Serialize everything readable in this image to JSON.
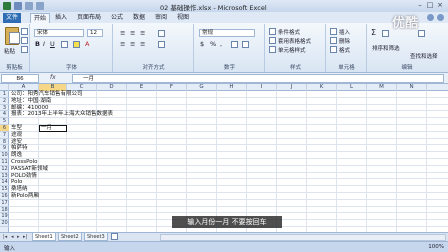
{
  "window": {
    "title": "02 基础操作.xlsx - Microsoft Excel",
    "controls": [
      "–",
      "□",
      "×"
    ]
  },
  "tabs": [
    "文件",
    "开始",
    "插入",
    "页面布局",
    "公式",
    "数据",
    "审阅",
    "视图"
  ],
  "active_tab": "开始",
  "ribbon": {
    "groups": [
      "剪贴板",
      "字体",
      "对齐方式",
      "数字",
      "样式",
      "单元格",
      "编辑"
    ],
    "font_name": "宋体",
    "font_size": "12",
    "number_format": "常规",
    "styles": [
      "条件格式",
      "套用表格格式",
      "单元格样式"
    ],
    "cells": [
      "插入",
      "删除",
      "格式"
    ],
    "editing": [
      "排序和筛选",
      "查找和选择"
    ],
    "paste_label": "粘贴"
  },
  "formula_bar": {
    "name_box": "B6",
    "fx": "fx",
    "content": "一月"
  },
  "columns": [
    "A",
    "B",
    "C",
    "D",
    "E",
    "F",
    "G",
    "H",
    "I",
    "J",
    "K",
    "L",
    "M",
    "N"
  ],
  "rows": [
    "1",
    "2",
    "3",
    "4",
    "5",
    "6",
    "7",
    "8",
    "9",
    "10",
    "11",
    "12",
    "13",
    "14",
    "15",
    "16",
    "17",
    "18",
    "19",
    "20"
  ],
  "cells": {
    "a1": "公司：阳秀汽车销售有限公司",
    "a2": "地址：中国·湖南",
    "a3": "邮编：410000",
    "a4": "报表：2013年上半年上海大众销售数据表",
    "a6": "车型",
    "a7": "途观",
    "a8": "途安",
    "a9": "帕萨特",
    "a10": "朗逸",
    "a11": "CrossPolo",
    "a12": "PASSAT新领域",
    "a13": "POLO劲情",
    "a14": "Polo",
    "a15": "桑塔纳",
    "a16": "新Polo两厢",
    "b6": "一月"
  },
  "sheets": [
    "Sheet1",
    "Sheet2",
    "Sheet3"
  ],
  "status": {
    "mode": "输入",
    "zoom": "100%"
  },
  "subtitle": "输入月份一月  不要按回车",
  "watermark": "优酷"
}
